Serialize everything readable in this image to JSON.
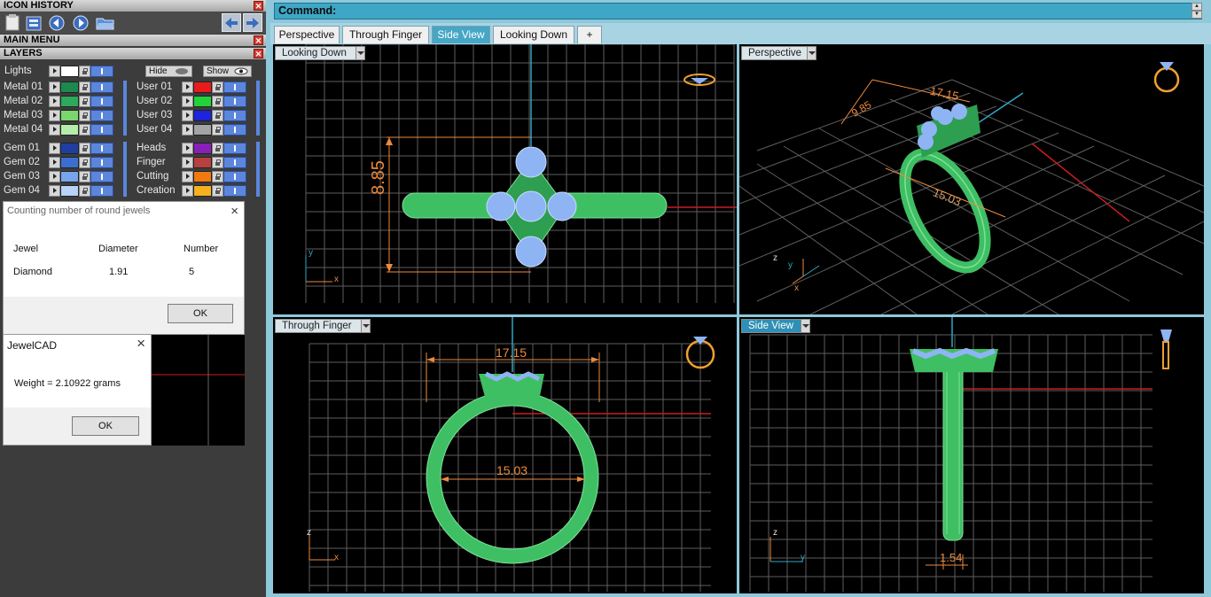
{
  "left_panel": {
    "icon_history_title": "ICON HISTORY",
    "main_menu_title": "MAIN MENU",
    "layers_title": "LAYERS",
    "close_glyph": "✕",
    "lights_label": "Lights",
    "hide_label": "Hide",
    "show_label": "Show",
    "metal_layers": [
      {
        "label": "Metal 01",
        "color": "#1c8a4c"
      },
      {
        "label": "Metal 02",
        "color": "#2ea85a"
      },
      {
        "label": "Metal 03",
        "color": "#7ad66f"
      },
      {
        "label": "Metal 04",
        "color": "#b4edaa"
      }
    ],
    "user_layers": [
      {
        "label": "User 01",
        "color": "#e81c1c"
      },
      {
        "label": "User 02",
        "color": "#22d23a"
      },
      {
        "label": "User 03",
        "color": "#1c24dc"
      },
      {
        "label": "User 04",
        "color": "#a4a4a4"
      }
    ],
    "gem_layers": [
      {
        "label": "Gem 01",
        "color": "#1e3fa0"
      },
      {
        "label": "Gem 02",
        "color": "#3c6ed2"
      },
      {
        "label": "Gem 03",
        "color": "#78a4ee"
      },
      {
        "label": "Gem 04",
        "color": "#b8d2f8"
      }
    ],
    "other_layers": [
      {
        "label": "Heads",
        "color": "#8a1fb8"
      },
      {
        "label": "Finger",
        "color": "#b84040"
      },
      {
        "label": "Cutting",
        "color": "#f07a10"
      },
      {
        "label": "Creation",
        "color": "#f6b020"
      }
    ]
  },
  "jewels_dialog": {
    "title": "Counting number of round jewels",
    "col_jewel": "Jewel",
    "col_diameter": "Diameter",
    "col_number": "Number",
    "row_jewel": "Diamond",
    "row_diameter": "1.91",
    "row_number": "5",
    "ok_label": "OK"
  },
  "weight_dialog": {
    "title": "JewelCAD",
    "message": "Weight = 2.10922 grams",
    "ok_label": "OK"
  },
  "command_bar": {
    "label": "Command:",
    "scroll_up": "▲",
    "scroll_down": "▼"
  },
  "tabs": [
    {
      "label": "Perspective",
      "active": false
    },
    {
      "label": "Through Finger",
      "active": false
    },
    {
      "label": "Side View",
      "active": true
    },
    {
      "label": "Looking Down",
      "active": false
    },
    {
      "label": "+",
      "active": false
    }
  ],
  "viewports": {
    "looking_down": {
      "label": "Looking Down",
      "dimension": "8.85",
      "axis_v": "y",
      "axis_h": "x"
    },
    "perspective": {
      "label": "Perspective",
      "dimension_top": "17.15",
      "dimension_side": "9.85",
      "dimension_inner": "15.03",
      "axis_z": "z",
      "axis_y": "y",
      "axis_x": "x"
    },
    "through_finger": {
      "label": "Through Finger",
      "dimension_top": "17.15",
      "dimension_inner": "15.03",
      "axis_v": "z",
      "axis_h": "x"
    },
    "side_view": {
      "label": "Side View",
      "dimension_bottom": "1.54",
      "axis_v": "z",
      "axis_h": "y"
    }
  },
  "colors": {
    "ring_green": "#3fbf63",
    "gem_blue": "#8fb4f4",
    "dimension_orange": "#ee8a3c",
    "grid_gray": "#5e5e5e",
    "axis_red": "#c81e1e",
    "axis_cyan": "#2fa6c4",
    "accent_cyan": "#3fa7c6"
  }
}
